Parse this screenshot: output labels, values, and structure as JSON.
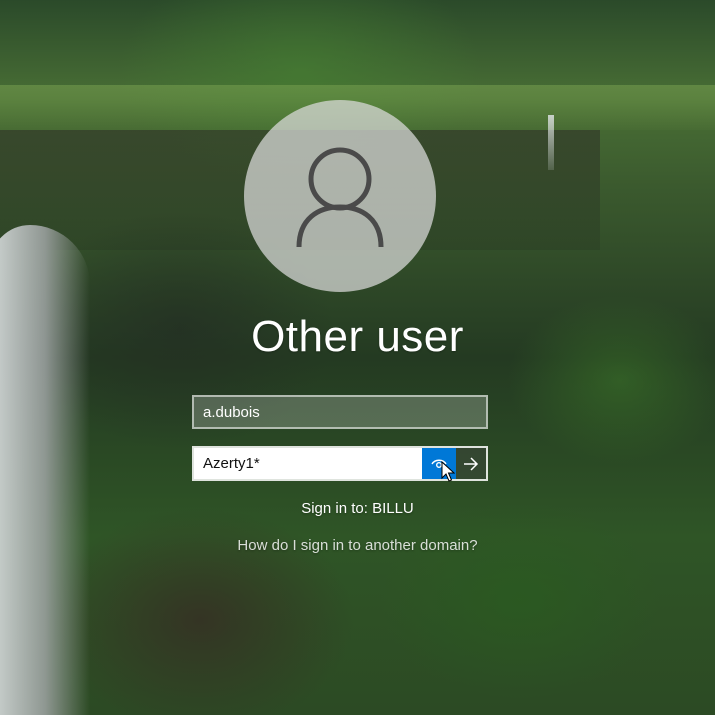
{
  "login": {
    "user_title": "Other user",
    "username_value": "a.dubois",
    "password_value": "Azerty1*",
    "sign_in_to": "Sign in to: BILLU",
    "other_domain_link": "How do I sign in to another domain?"
  },
  "icons": {
    "avatar": "user-silhouette-icon",
    "reveal": "eye-icon",
    "submit": "arrow-right-icon",
    "cursor": "mouse-pointer-icon"
  },
  "colors": {
    "accent": "#0078d7"
  }
}
